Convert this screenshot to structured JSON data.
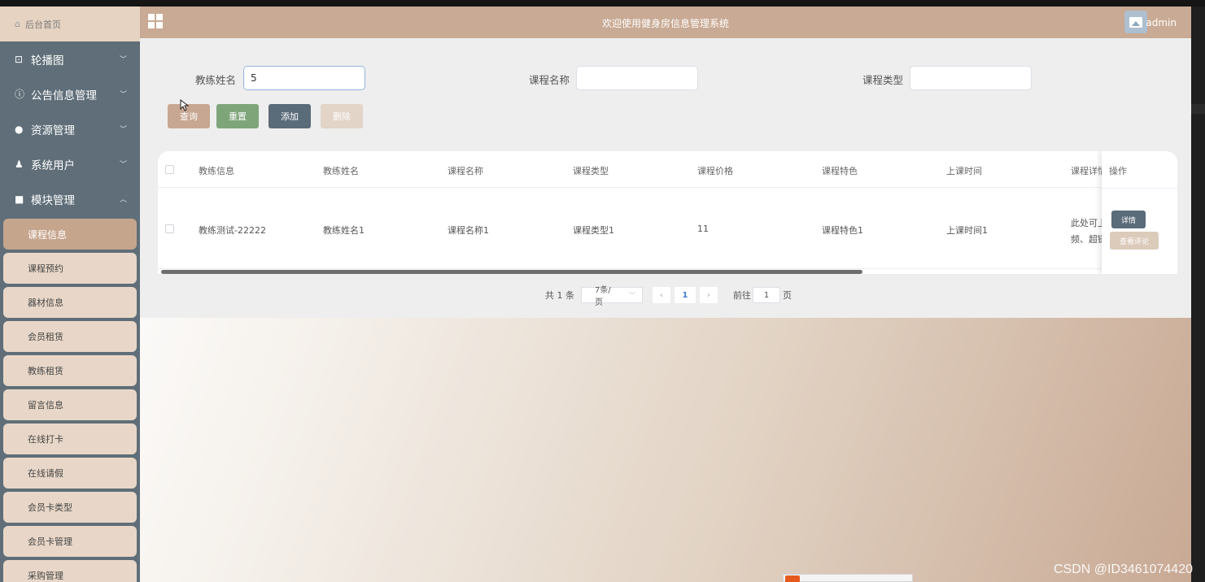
{
  "header": {
    "title": "欢迎使用健身房信息管理系统",
    "user": "admin"
  },
  "sidebar": {
    "home": "后台首页",
    "menus": [
      {
        "label": "轮播图",
        "icon": "image-icon",
        "glyph": "⊡"
      },
      {
        "label": "公告信息管理",
        "icon": "info-icon",
        "glyph": "ⓘ"
      },
      {
        "label": "资源管理",
        "icon": "lightbulb-icon",
        "glyph": "●"
      },
      {
        "label": "系统用户",
        "icon": "user-icon",
        "glyph": "♟"
      },
      {
        "label": "模块管理",
        "icon": "grid-icon",
        "glyph": "■"
      }
    ],
    "sub_items": [
      "课程信息",
      "课程预约",
      "器材信息",
      "会员租赁",
      "教练租赁",
      "留言信息",
      "在线打卡",
      "在线请假",
      "会员卡类型",
      "会员卡管理",
      "采购管理"
    ]
  },
  "search": {
    "coach_label": "教练姓名",
    "coach_value": "5",
    "course_label": "课程名称",
    "course_value": "",
    "type_label": "课程类型",
    "type_value": ""
  },
  "buttons": {
    "query": "查询",
    "reset": "重置",
    "add": "添加",
    "delete": "删除"
  },
  "table": {
    "columns": [
      "教练信息",
      "教练姓名",
      "课程名称",
      "课程类型",
      "课程价格",
      "课程特色",
      "上课时间",
      "课程详情",
      "操作"
    ],
    "rows": [
      {
        "coach_info": "教练测试-22222",
        "coach_name": "教练姓名1",
        "course_name": "课程名称1",
        "course_type": "课程类型1",
        "price": "11",
        "feature": "课程特色1",
        "time": "上课时间1",
        "detail_line1": "此处可上",
        "detail_line2": "频、超链",
        "op_detail": "详情",
        "op_comment": "查看评论"
      }
    ]
  },
  "pagination": {
    "total": "共 1 条",
    "page_size": "7条/页",
    "current": "1",
    "goto_label": "前往",
    "goto_value": "1",
    "page_suffix": "页"
  },
  "watermark": "CSDN @ID3461074420",
  "colors": {
    "sidebar": "#5f6e78",
    "header": "#c9aa94",
    "accent_active": "#c6a58d",
    "reset_green": "#7ea57a",
    "add_slate": "#5a6b79"
  }
}
